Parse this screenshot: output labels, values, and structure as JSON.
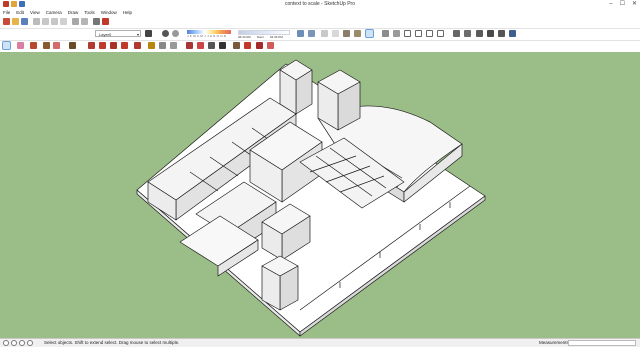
{
  "window": {
    "title": "context to scale - SketchUp Pro",
    "controls": [
      "–",
      "☐",
      "✕"
    ]
  },
  "menu": [
    "File",
    "Edit",
    "View",
    "Camera",
    "Draw",
    "Tools",
    "Window",
    "Help"
  ],
  "toolbar": {
    "layer_value": "Layer0",
    "shadow_months": "J F M A M J J A S O N D",
    "time_start": "06:43 AM",
    "time_mid": "Noon",
    "time_end": "04:46 PM"
  },
  "status": {
    "message": "Select objects. Shift to extend select. Drag mouse to select multiple.",
    "measurements_label": "Measurements",
    "measurements_value": ""
  },
  "colors": {
    "sky_ground": "#9bbd87",
    "accent_selected": "#cfe3f7",
    "model_fill": "#ffffff",
    "model_edge": "#1a1a1a"
  }
}
